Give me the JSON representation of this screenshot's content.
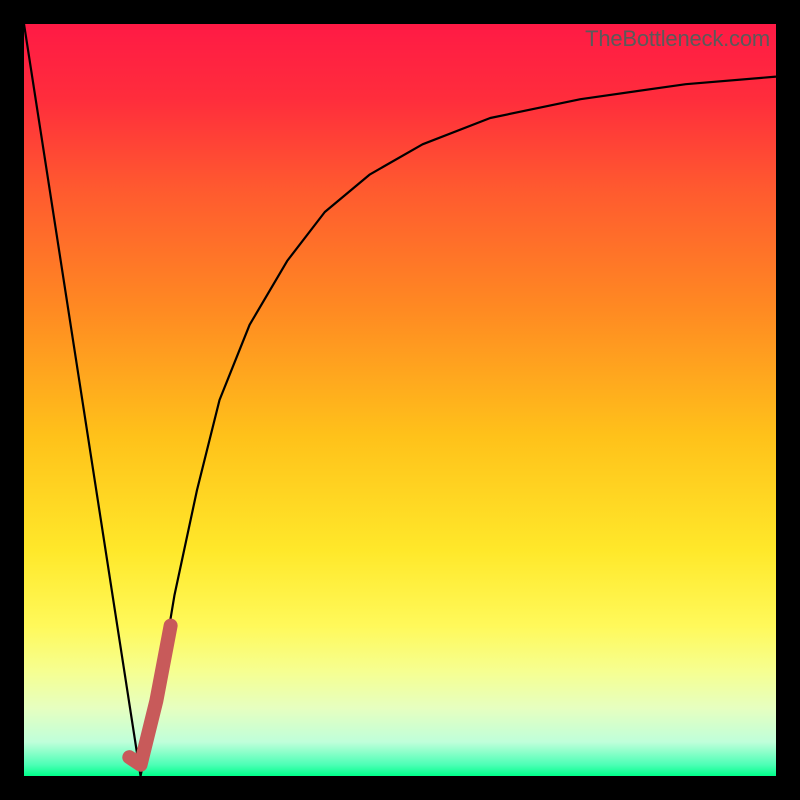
{
  "watermark": {
    "text": "TheBottleneck.com"
  },
  "chart_data": {
    "type": "line",
    "title": "",
    "xlabel": "",
    "ylabel": "",
    "xlim": [
      0,
      100
    ],
    "ylim": [
      0,
      100
    ],
    "series": [
      {
        "name": "left-descent",
        "x": [
          0,
          15.5
        ],
        "values": [
          100,
          0
        ]
      },
      {
        "name": "right-curve",
        "x": [
          15.5,
          18,
          20,
          23,
          26,
          30,
          35,
          40,
          46,
          53,
          62,
          74,
          88,
          100
        ],
        "values": [
          0,
          12,
          24,
          38,
          50,
          60,
          68.5,
          75,
          80,
          84,
          87.5,
          90,
          92,
          93
        ]
      },
      {
        "name": "highlight",
        "x": [
          14,
          15.5,
          17.6,
          19.5
        ],
        "values": [
          2.5,
          1.5,
          10,
          20
        ]
      }
    ],
    "gradient_stops": [
      {
        "offset": 0,
        "color": "#ff1a45"
      },
      {
        "offset": 0.1,
        "color": "#ff2d3c"
      },
      {
        "offset": 0.22,
        "color": "#ff5a2f"
      },
      {
        "offset": 0.38,
        "color": "#ff8a22"
      },
      {
        "offset": 0.55,
        "color": "#ffc21a"
      },
      {
        "offset": 0.7,
        "color": "#ffe82a"
      },
      {
        "offset": 0.8,
        "color": "#fff95a"
      },
      {
        "offset": 0.86,
        "color": "#f6ff90"
      },
      {
        "offset": 0.91,
        "color": "#e6ffc0"
      },
      {
        "offset": 0.955,
        "color": "#bfffda"
      },
      {
        "offset": 0.985,
        "color": "#4dffb6"
      },
      {
        "offset": 1.0,
        "color": "#00ff8a"
      }
    ],
    "highlight_color": "#c85a5a"
  }
}
